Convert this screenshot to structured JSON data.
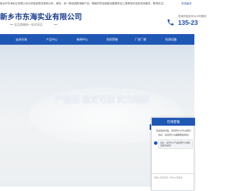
{
  "topbar": {
    "notice": "新乡市东海实业有限公司为您免费提供各种分料、原料、统一精品销售规格产品、精致好质及配套设备服务加工具等相关信息咨询服务，敬请关注！",
    "link": "在线留言"
  },
  "brand": {
    "name": "新乡市东海实业有限公司",
    "slogan": "全品类精选一站式采买"
  },
  "phone": {
    "label": "咨询热线全天24小时服务",
    "number": "135-23"
  },
  "nav": {
    "items": [
      {
        "label": "走进东海"
      },
      {
        "label": "产品中心"
      },
      {
        "label": "新闻中心"
      },
      {
        "label": "资质荣誉"
      },
      {
        "label": "厂房厂貌"
      },
      {
        "label": "检测设备"
      }
    ]
  },
  "banner": {
    "line1": "月产2000万件",
    "line2": "产能强  稳定可靠  实力雄厚"
  },
  "chat": {
    "title": "在线客服",
    "line1": "欢迎您的光临，请问有什么可以帮您？",
    "line2": "您好，请问有什么需要帮助的吗？",
    "bubble": "您好，请问什么产品需要什么规格需要咨询呢？",
    "input_hint": "请输入您的问题，按Enter键发送"
  },
  "colors": {
    "brand_blue": "#1f57b5",
    "title_blue": "#1d3f8f"
  }
}
